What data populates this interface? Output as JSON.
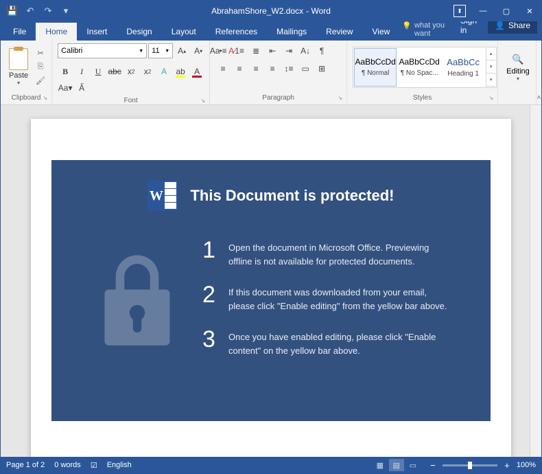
{
  "title": {
    "filename": "AbrahamShore_W2.docx",
    "suffix": " - Word"
  },
  "qat": {
    "save": "💾",
    "undo": "↶",
    "redo": "↷"
  },
  "wincontrols": {
    "ribbonopts": "▾",
    "min": "—",
    "max": "▢",
    "close": "✕"
  },
  "tabs": {
    "file": "File",
    "home": "Home",
    "insert": "Insert",
    "design": "Design",
    "layout": "Layout",
    "references": "References",
    "mailings": "Mailings",
    "review": "Review",
    "view": "View"
  },
  "tellme": "Tell me what you want",
  "signin": "Sign in",
  "share": "Share",
  "ribbon": {
    "clipboard": {
      "paste": "Paste",
      "label": "Clipboard"
    },
    "font": {
      "name": "Calibri",
      "size": "11",
      "bold": "B",
      "italic": "I",
      "underline": "U",
      "strike": "abc",
      "sub": "x",
      "sup": "x",
      "case": "Aa",
      "clear": "A",
      "fontcolor": "A",
      "highlight": "ab",
      "grow": "A",
      "shrink": "A",
      "label": "Font"
    },
    "paragraph": {
      "label": "Paragraph"
    },
    "styles": {
      "label": "Styles",
      "items": [
        {
          "sample": "AaBbCcDd",
          "name": "¶ Normal"
        },
        {
          "sample": "AaBbCcDd",
          "name": "¶ No Spac..."
        },
        {
          "sample": "AaBbCc",
          "name": "Heading 1"
        }
      ]
    },
    "editing": {
      "label": "Editing",
      "btn": "Editing"
    }
  },
  "document": {
    "title": "This Document is protected!",
    "steps": [
      {
        "n": "1",
        "t": "Open the document in Microsoft Office. Previewing offline is not available for protected documents."
      },
      {
        "n": "2",
        "t": "If this document was downloaded from your email, please click \"Enable editing\" from the yellow bar above."
      },
      {
        "n": "3",
        "t": "Once you have enabled editing, please click \"Enable content\" on the yellow bar above."
      }
    ]
  },
  "status": {
    "page": "Page 1 of 2",
    "words": "0 words",
    "lang": "English",
    "zoom": "100%",
    "minus": "−",
    "plus": "+"
  }
}
